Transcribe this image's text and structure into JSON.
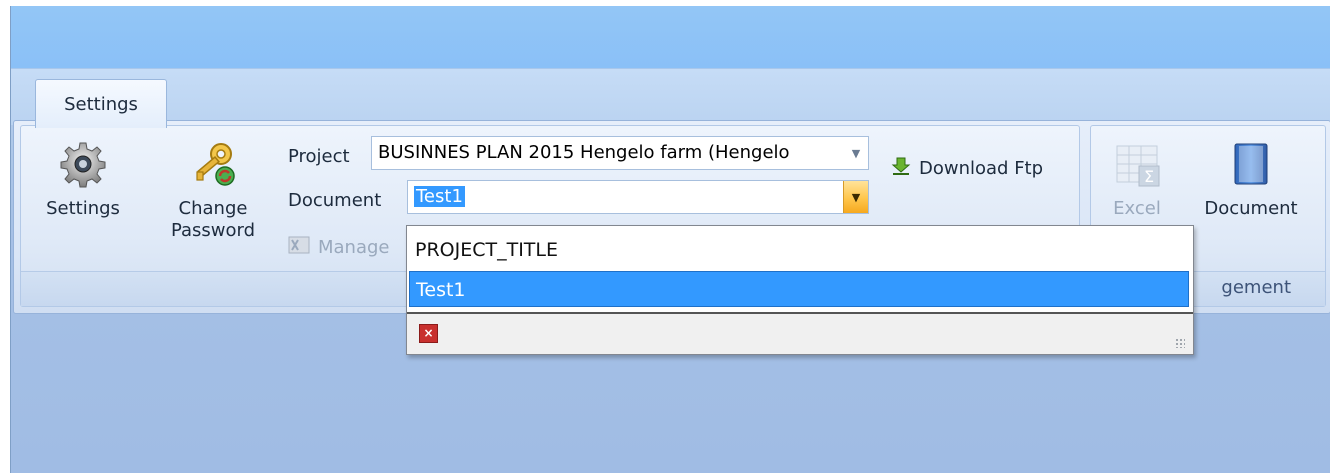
{
  "tabs": [
    {
      "label": "Settings"
    }
  ],
  "ribbon": {
    "settings_label": "Settings",
    "change_password_label": [
      "Change",
      "Password"
    ],
    "project_label": "Project",
    "project_value": "BUSINNES PLAN 2015  Hengelo farm (Hengelo",
    "document_label": "Document",
    "document_value": "Test1",
    "manage_label": "Manage",
    "download_ftp_label": "Download Ftp",
    "excel_label": "Excel",
    "document_button_label": "Document",
    "group2_footer": "gement"
  },
  "dropdown": {
    "items": [
      "PROJECT_TITLE",
      "Test1"
    ],
    "selected": "Test1"
  },
  "colors": {
    "selection": "#3399ff",
    "active_arrow": "#ffc64c",
    "close": "#c8302e"
  }
}
